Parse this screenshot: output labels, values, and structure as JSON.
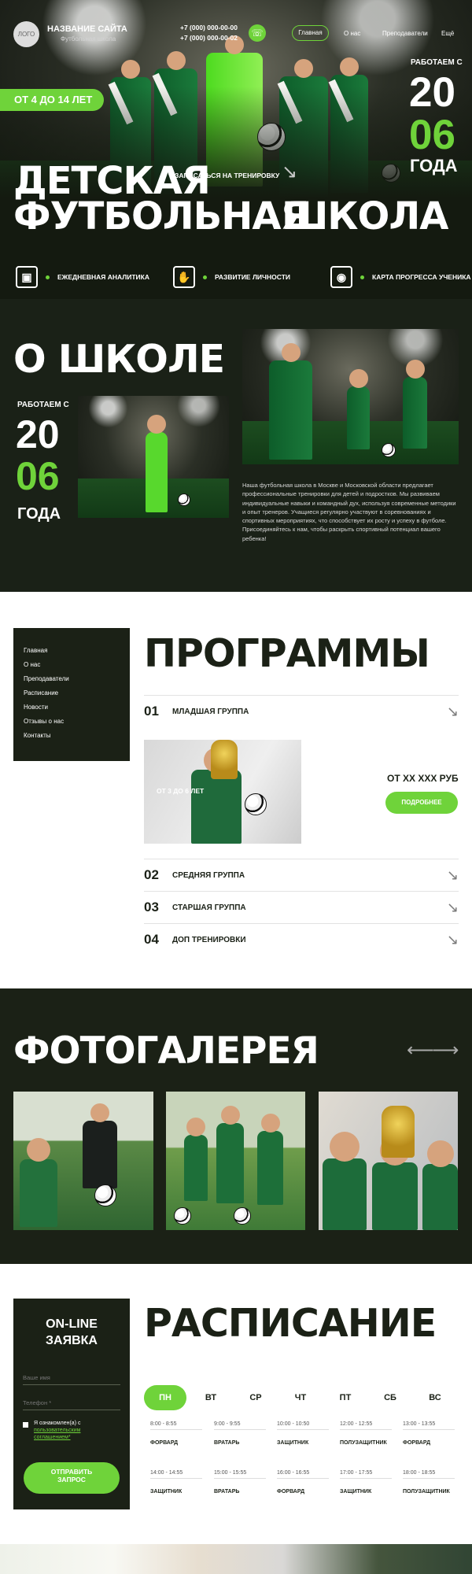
{
  "header": {
    "logo": "ЛОГО",
    "site_name": "НАЗВАНИЕ САЙТА",
    "site_subtitle": "Футбольная школа",
    "phone1": "+7 (000) 000-00-00",
    "phone2": "+7 (000) 000-00-02",
    "nav": [
      "Главная",
      "О нас",
      "Преподаватели",
      "Ещё"
    ]
  },
  "hero": {
    "age": "ОТ 4 ДО 14 ЛЕТ",
    "works_since": "РАБОТАЕМ С",
    "year_top": "20",
    "year_bottom": "06",
    "years_word": "ГОДА",
    "cta": "ЗАПИСАТЬСЯ НА ТРЕНИРОВКУ",
    "title_line1": "ДЕТСКАЯ",
    "title_green": "ФУТБОЛЬНАЯ",
    "title_white": "ШКОЛА",
    "features": [
      "ЕЖЕДНЕВНАЯ АНАЛИТИКА",
      "РАЗВИТИЕ ЛИЧНОСТИ",
      "КАРТА ПРОГРЕССА УЧЕНИКА"
    ]
  },
  "about": {
    "title": "О ШКОЛЕ",
    "works_since": "РАБОТАЕМ С",
    "year_top": "20",
    "year_bottom": "06",
    "years_word": "ГОДА",
    "text": "Наша футбольная школа в Москве и Московской области предлагает профессиональные тренировки для детей и подростков. Мы развиваем индивидуальные навыки и командный дух, используя современные методики и опыт тренеров. Учащиеся регулярно участвуют в соревнованиях и спортивных мероприятиях, что способствует их росту и успеху в футболе. Присоединяйтесь к нам, чтобы раскрыть спортивный потенциал вашего ребенка!"
  },
  "menu": [
    "Главная",
    "О нас",
    "Преподаватели",
    "Расписание",
    "Новости",
    "Отзывы о нас",
    "Контакты"
  ],
  "programs": {
    "title": "ПРОГРАММЫ",
    "rows": [
      {
        "num": "01",
        "name": "МЛАДШАЯ ГРУППА"
      },
      {
        "num": "02",
        "name": "СРЕДНЯЯ ГРУППА"
      },
      {
        "num": "03",
        "name": "СТАРШАЯ ГРУППА"
      },
      {
        "num": "04",
        "name": "ДОП ТРЕНИРОВКИ"
      }
    ],
    "age": "ОТ 3 ДО 6 ЛЕТ",
    "price": "ОТ ХХ ХХХ РУБ",
    "more": "ПОДРОБНЕЕ"
  },
  "gallery": {
    "title": "ФОТОГАЛЕРЕЯ"
  },
  "form": {
    "title1": "ON-LINE",
    "title2": "ЗАЯВКА",
    "name_placeholder": "Ваше имя",
    "phone_placeholder": "Телефон *",
    "agree1": "Я ознакомлен(а) с",
    "agree2": "пользовательским",
    "agree3": "соглашением*",
    "submit1": "ОТПРАВИТЬ",
    "submit2": "ЗАПРОС"
  },
  "schedule": {
    "title": "РАСПИСАНИЕ",
    "days": [
      "ПН",
      "ВТ",
      "СР",
      "ЧТ",
      "ПТ",
      "СБ",
      "ВС"
    ],
    "row1": [
      {
        "time": "8:00 - 8:55",
        "role": "ФОРВАРД"
      },
      {
        "time": "9:00 - 9:55",
        "role": "ВРАТАРЬ"
      },
      {
        "time": "10:00 - 10:50",
        "role": "ЗАЩИТНИК"
      },
      {
        "time": "12:00 - 12:55",
        "role": "ПОЛУЗАЩИТНИК"
      },
      {
        "time": "13:00 - 13:55",
        "role": "ФОРВАРД"
      }
    ],
    "row2": [
      {
        "time": "14:00 - 14:55",
        "role": "ЗАЩИТНИК"
      },
      {
        "time": "15:00 - 15:55",
        "role": "ВРАТАРЬ"
      },
      {
        "time": "16:00 - 16:55",
        "role": "ФОРВАРД"
      },
      {
        "time": "17:00 - 17:55",
        "role": "ЗАЩИТНИК"
      },
      {
        "time": "18:00 - 18:55",
        "role": "ПОЛУЗАЩИТНИК"
      }
    ]
  },
  "icons": {
    "phone": "phone-icon",
    "arrow": "arrow-diagonal-icon"
  },
  "colors": {
    "green": "#6fd33a",
    "dark": "#1b2116"
  }
}
